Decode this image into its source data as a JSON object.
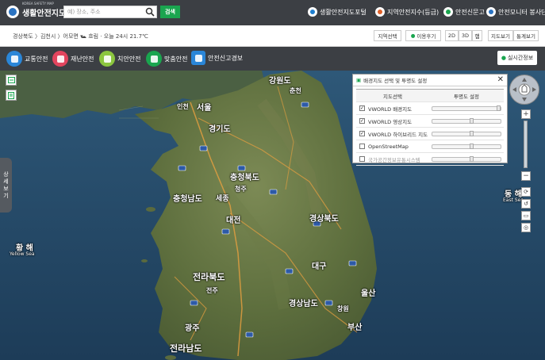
{
  "header": {
    "logo_sub": "KOREA SAFETY MAP",
    "logo_title": "생활안전지도",
    "search_placeholder": "예) 장소, 주소",
    "search_button": "검색",
    "links": [
      {
        "label": "생활안전지도포털",
        "color": "#1e7fd0"
      },
      {
        "label": "지역안전지수(등급)",
        "color": "#e0612a"
      },
      {
        "label": "안전신문고",
        "color": "#1aa54f"
      },
      {
        "label": "안전모니터 봉사단",
        "color": "#2a73c2"
      }
    ]
  },
  "subbar": {
    "location": "경상북도 〉김천시 〉어모면",
    "weather": "흐림 · 오늘 24시 21.7℃",
    "region_select": "지역선택",
    "feedback": "이용후기",
    "view_2d": "2D",
    "view_3d": "3D",
    "view_extra": "햄",
    "map_view": "지도보기",
    "stats_view": "통계보기"
  },
  "categories": [
    {
      "label": "교통안전",
      "color": "#2a86d8"
    },
    {
      "label": "재난안전",
      "color": "#e2455e"
    },
    {
      "label": "치안안전",
      "color": "#8cc63f"
    },
    {
      "label": "맞춤안전",
      "color": "#1aa54f"
    },
    {
      "label": "안전신고경보",
      "color": "#2a86d8"
    }
  ],
  "realtime_btn": "실시간정보",
  "side_tab": [
    "상",
    "세",
    "보",
    "기"
  ],
  "panel": {
    "title": "배경지도 선택 및 투명도 설정",
    "col_map": "지도선택",
    "col_opacity": "투명도 설정",
    "rows": [
      {
        "label": "VWORLD 배경지도",
        "checked": true,
        "level": 1.0
      },
      {
        "label": "VWORLD 영상지도",
        "checked": true,
        "level": 0.6
      },
      {
        "label": "VWORLD 하이브리드 지도",
        "checked": true,
        "level": 0.6
      },
      {
        "label": "OpenStreetMap",
        "checked": false,
        "level": 0.6
      },
      {
        "label": "국가공간정보유통시스템",
        "checked": false,
        "level": 0.6
      }
    ]
  },
  "map_labels": {
    "gangwon": "강원도",
    "seoul": "서울",
    "gyeonggi": "경기도",
    "chungbuk": "충청북도",
    "chungnam": "충청남도",
    "sejong": "세종",
    "daejeon": "대전",
    "gyeongbuk": "경상북도",
    "daegu": "대구",
    "jeonbuk": "전라북도",
    "gyeongnam": "경상남도",
    "ulsan": "울산",
    "busan": "부산",
    "gwangju": "광주",
    "jeonnam": "전라남도",
    "yellow_sea_ko": "황 해",
    "yellow_sea_en": "Yellow Sea",
    "east_sea_ko": "동 해",
    "east_sea_en": "East Sea",
    "incheon": "인천",
    "jeonju": "전주",
    "chuncheon": "춘천",
    "cheongju": "청주",
    "changwon": "창원"
  }
}
